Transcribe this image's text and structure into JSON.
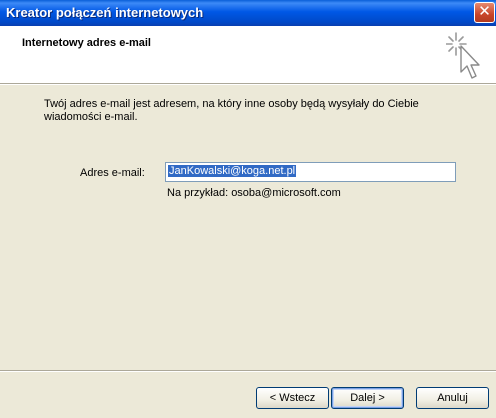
{
  "window": {
    "title": "Kreator połączeń internetowych",
    "close_glyph": "✕"
  },
  "header": {
    "title": "Internetowy adres e-mail",
    "icon": "wizard-cursor-sparkle-icon"
  },
  "body": {
    "description": "Twój adres e-mail jest adresem, na który inne osoby będą wysyłały do Ciebie wiadomości e-mail.",
    "email_label": "Adres e-mail:",
    "email_value": "JanKowalski@koga.net.pl",
    "example": "Na przykład: osoba@microsoft.com"
  },
  "buttons": {
    "back": "< Wstecz",
    "next": "Dalej >",
    "cancel": "Anuluj"
  },
  "colors": {
    "title_bar": "#0058e6",
    "selection": "#316ac5",
    "dialog_bg": "#ece9d8"
  }
}
